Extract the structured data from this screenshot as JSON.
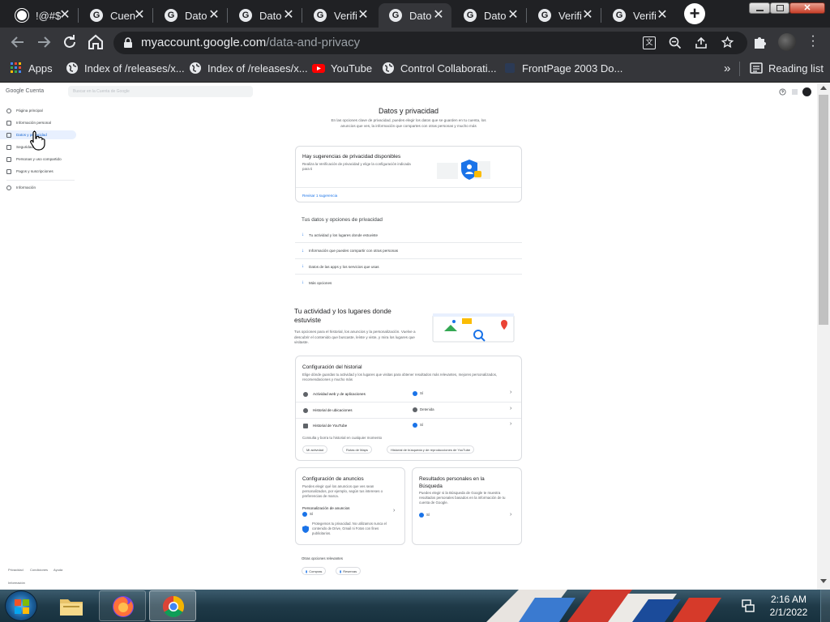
{
  "browser": {
    "tabs": [
      {
        "title": "!@#$",
        "active": false
      },
      {
        "title": "Cuen",
        "active": false
      },
      {
        "title": "Dato",
        "active": false
      },
      {
        "title": "Dato",
        "active": false
      },
      {
        "title": "Verifi",
        "active": false
      },
      {
        "title": "Dato",
        "active": true
      },
      {
        "title": "Dato",
        "active": false
      },
      {
        "title": "Verifi",
        "active": false
      },
      {
        "title": "Verifi",
        "active": false
      }
    ],
    "url_host": "myaccount.google.com",
    "url_path": "/data-and-privacy",
    "bookmarks": [
      {
        "label": "Apps",
        "icon": "apps-grid-icon"
      },
      {
        "label": "Index of /releases/x...",
        "icon": "globe-icon"
      },
      {
        "label": "Index of /releases/x...",
        "icon": "globe-icon"
      },
      {
        "label": "YouTube",
        "icon": "youtube-icon"
      },
      {
        "label": "Control Collaborati...",
        "icon": "globe-icon"
      },
      {
        "label": "FrontPage 2003 Do...",
        "icon": "frontpage-icon"
      }
    ],
    "reading_list": "Reading list",
    "more_bookmarks": "»"
  },
  "account": {
    "logo_google": "Google",
    "logo_cuenta": "Cuenta",
    "search_placeholder": "Buscar en la Cuenta de Google",
    "nav": [
      {
        "label": "Página principal",
        "icon": "home-icon"
      },
      {
        "label": "Información personal",
        "icon": "id-card-icon"
      },
      {
        "label": "Datos y privacidad",
        "icon": "toggle-icon",
        "active": true
      },
      {
        "label": "Seguridad",
        "icon": "lock-icon"
      },
      {
        "label": "Personas y uso compartido",
        "icon": "people-icon"
      },
      {
        "label": "Pagos y suscripciones",
        "icon": "card-icon"
      },
      {
        "label": "Información",
        "icon": "info-icon"
      }
    ],
    "footer_links": [
      "Privacidad",
      "Condiciones",
      "Ayuda",
      "Información"
    ]
  },
  "main": {
    "title": "Datos y privacidad",
    "intro": "En las opciones clave de privacidad, puedes elegir los datos que se guarden en tu cuenta, los anuncios que ves, la información que compartes con otras personas y mucho más",
    "suggestion_card": {
      "title": "Hay sugerencias de privacidad disponibles",
      "text": "Realiza la Verificación de privacidad y elige la configuración indicada para ti",
      "link": "Revisar 1 sugerencia"
    },
    "options_heading": "Tus datos y opciones de privacidad",
    "options": [
      "Tu actividad y los lugares donde estuviste",
      "Información que puedes compartir con otras personas",
      "Datos de las apps y los servicios que usas",
      "Más opciones"
    ],
    "activity": {
      "heading_line1": "Tu actividad y los lugares donde",
      "heading_line2": "estuviste",
      "text": "Tus opciones para el historial, los anuncios y la personalización. Vuelve a descubrir el contenido que buscaste, leíste y viste, y mira los lugares que visitaste."
    },
    "history_card": {
      "title": "Configuración del historial",
      "text": "Elige dónde guardas tu actividad y los lugares que visitas para obtener resultados más relevantes, mejores personalizados, recomendaciones y mucho más",
      "rows": [
        {
          "label": "Actividad web y de aplicaciones",
          "status": "Sí",
          "on": true
        },
        {
          "label": "Historial de ubicaciones",
          "status": "Detenida",
          "on": false
        },
        {
          "label": "Historial de YouTube",
          "status": "Sí",
          "on": true
        }
      ],
      "footer_text": "Consulta y borra tu historial en cualquier momento",
      "chips": [
        "Mi actividad",
        "Rutas de Maps",
        "Historial de búsqueda y de reproducciones de YouTube"
      ]
    },
    "ads_card": {
      "title": "Configuración de anuncios",
      "text": "Puedes elegir qué los anuncios que ves sean personalizados, por ejemplo, según tus intereses o preferencias de marca.",
      "row_label": "Personalización de anuncios",
      "row_status": "Sí",
      "protect_text": "Protegemos tu privacidad. No utilizamos nunca el contenido de Drive, Gmail ni Fotos con fines publicitarios."
    },
    "search_card": {
      "title_line1": "Resultados personales en la",
      "title_line2": "Búsqueda",
      "text": "Puedes elegir si la Búsqueda de Google te muestra resultados personales basados en la información de tu cuenta de Google.",
      "status": "Sí"
    },
    "other_heading": "Otras opciones relevantes",
    "other_chips": [
      "Compras",
      "Reservas"
    ]
  },
  "taskbar": {
    "time": "2:16 AM",
    "date": "2/1/2022"
  },
  "colors": {
    "tab_bg": "#202124",
    "toolbar_bg": "#35363a",
    "google_blue": "#1a73e8"
  }
}
